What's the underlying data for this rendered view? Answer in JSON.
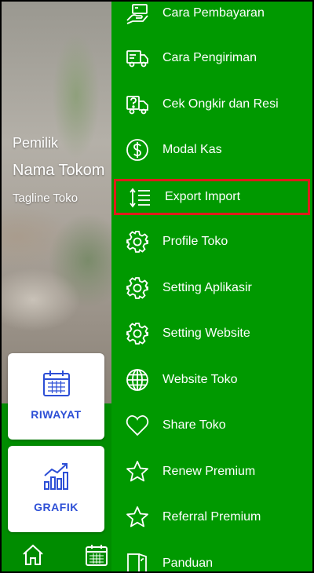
{
  "profile": {
    "owner_label": "Pemilik",
    "store_name": "Nama Tokom",
    "tagline": "Tagline Toko"
  },
  "cards": [
    {
      "label": "RIWAYAT",
      "icon": "calendar-icon"
    },
    {
      "label": "GRAFIK",
      "icon": "bar-chart-icon"
    }
  ],
  "bottom_nav": [
    {
      "icon": "home-icon"
    },
    {
      "icon": "calendar-icon"
    }
  ],
  "menu": [
    {
      "label": "Cara Pembayaran",
      "icon": "payment-hand-icon"
    },
    {
      "label": "Cara Pengiriman",
      "icon": "delivery-truck-icon"
    },
    {
      "label": "Cek Ongkir dan Resi",
      "icon": "question-truck-icon"
    },
    {
      "label": "Modal Kas",
      "icon": "dollar-circle-icon"
    },
    {
      "label": "Export Import",
      "icon": "sort-list-icon",
      "highlighted": true
    },
    {
      "label": "Profile Toko",
      "icon": "gear-icon"
    },
    {
      "label": "Setting Aplikasir",
      "icon": "gear-icon"
    },
    {
      "label": "Setting Website",
      "icon": "gear-icon"
    },
    {
      "label": "Website Toko",
      "icon": "globe-icon"
    },
    {
      "label": "Share Toko",
      "icon": "heart-icon"
    },
    {
      "label": "Renew Premium",
      "icon": "star-icon"
    },
    {
      "label": "Referral Premium",
      "icon": "star-icon"
    },
    {
      "label": "Panduan",
      "icon": "guide-door-icon"
    }
  ],
  "colors": {
    "drawer_green": "#009900",
    "highlight_border": "#e01b1b",
    "card_label_blue": "#2d4fd6"
  }
}
